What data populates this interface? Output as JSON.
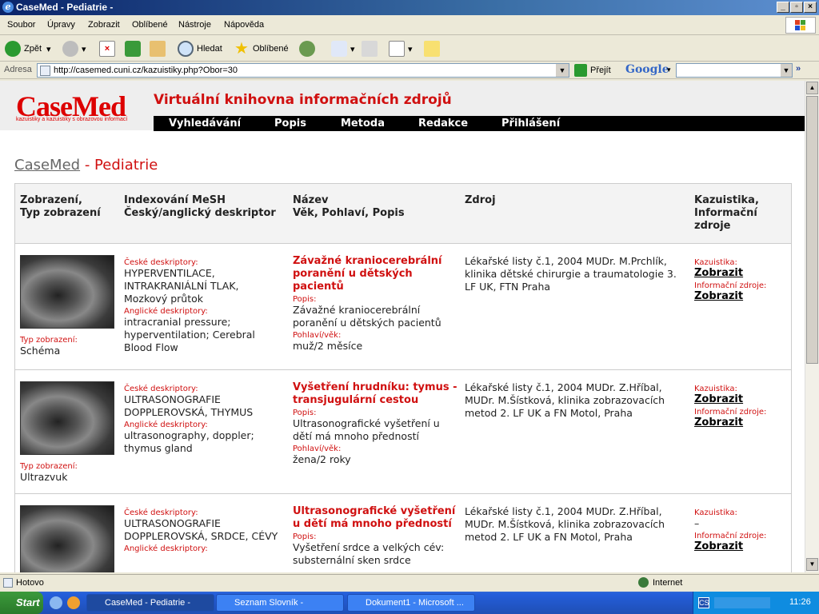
{
  "window": {
    "title": "CaseMed - Pediatrie -"
  },
  "menu": [
    "Soubor",
    "Úpravy",
    "Zobrazit",
    "Oblíbené",
    "Nástroje",
    "Nápověda"
  ],
  "toolbar": {
    "back": "Zpět",
    "search": "Hledat",
    "favorites": "Oblíbené"
  },
  "address": {
    "label": "Adresa",
    "url": "http://casemed.cuni.cz/kazuistiky.php?Obor=30",
    "go": "Přejít",
    "google": "Google"
  },
  "site": {
    "logo": "CaseMed",
    "logo_sub": "kazuistiky a kazuistiky s obrazovou informací",
    "title": "Virtuální knihovna informačních zdrojů",
    "nav": [
      "Vyhledávání",
      "Popis",
      "Metoda",
      "Redakce",
      "Přihlášení"
    ]
  },
  "breadcrumb": {
    "home": "CaseMed",
    "sep": "- Pediatrie"
  },
  "table": {
    "headers": [
      "Zobrazení,\nTyp zobrazení",
      "Indexování MeSH\nČeský/anglický deskriptor",
      "Název\nVěk, Pohlaví, Popis",
      "Zdroj",
      "Kazuistika,\nInformační\nzdroje"
    ],
    "labels": {
      "type": "Typ zobrazení:",
      "cz": "České deskriptory:",
      "en": "Anglické deskriptory:",
      "desc": "Popis:",
      "sex": "Pohlaví/věk:",
      "case": "Kazuistika:",
      "info": "Informační zdroje:",
      "show": "Zobrazit"
    },
    "rows": [
      {
        "type": "Schéma",
        "cz": "HYPERVENTILACE, INTRAKRANIÁLNÍ TLAK, Mozkový průtok",
        "en": "intracranial pressure; hyperventilation; Cerebral Blood Flow",
        "title": "Závažné kraniocerebrální poranění u dětských pacientů",
        "desc": "Závažné kraniocerebrální poranění u dětských pacientů",
        "sex": "muž/2 měsíce",
        "source": "Lékařské listy č.1, 2004 MUDr. M.Prchlík, klinika dětské chirurgie a traumatologie 3. LF UK, FTN Praha",
        "case": "Zobrazit",
        "info": "Zobrazit"
      },
      {
        "type": "Ultrazvuk",
        "cz": "ULTRASONOGRAFIE DOPPLEROVSKÁ, THYMUS",
        "en": "ultrasonography, doppler; thymus gland",
        "title": "Vyšetření hrudníku: tymus - transjugulární cestou",
        "desc": "Ultrasonografické vyšetření u dětí má mnoho předností",
        "sex": "žena/2 roky",
        "source": "Lékařské listy č.1, 2004 MUDr. Z.Hříbal, MUDr. M.Šístková, klinika zobrazovacích metod 2. LF UK a FN Motol, Praha",
        "case": "Zobrazit",
        "info": "Zobrazit"
      },
      {
        "type": "",
        "cz": "ULTRASONOGRAFIE DOPPLEROVSKÁ, SRDCE, CÉVY",
        "en": "",
        "title": "Ultrasonografické vyšetření u dětí má mnoho předností",
        "desc": "Vyšetření srdce a velkých cév: substernální sken srdce",
        "sex": "",
        "source": "Lékařské listy č.1, 2004 MUDr. Z.Hříbal, MUDr. M.Šístková, klinika zobrazovacích metod 2. LF UK a FN Motol, Praha",
        "case": "–",
        "info": "Zobrazit"
      }
    ]
  },
  "status": {
    "text": "Hotovo",
    "zone": "Internet"
  },
  "taskbar": {
    "start": "Start",
    "tasks": [
      "CaseMed - Pediatrie -",
      "Seznam Slovník -",
      "Dokument1 - Microsoft ..."
    ],
    "clock": "11:26"
  }
}
